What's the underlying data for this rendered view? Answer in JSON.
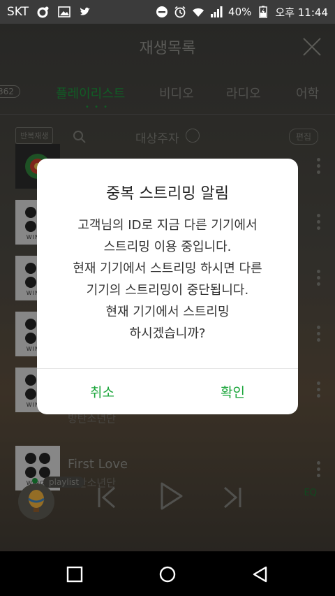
{
  "status_bar": {
    "carrier": "SKT",
    "battery": "40%",
    "time": "오후 11:44"
  },
  "header": {
    "title": "재생목록"
  },
  "tabs": {
    "count": "362",
    "items": [
      "플레이리스트",
      "비디오",
      "라디오",
      "어학"
    ],
    "active_index": 0
  },
  "toolbar": {
    "repeat_label": "반복재생",
    "sort_label": "대상주자",
    "edit_label": "편집"
  },
  "songs": [
    {
      "title": "First Love",
      "artist": "방탄소년단"
    },
    {
      "title": "",
      "artist": "방탄소년단"
    }
  ],
  "thumb_word": "WINGS",
  "player": {
    "playlist_label": "playlist",
    "eq_label": "EQ"
  },
  "dialog": {
    "title": "중복 스트리밍 알림",
    "lines": [
      "고객님의 ID로 지금 다른 기기에서",
      "스트리밍 이용 중입니다.",
      "현재 기기에서 스트리밍 하시면 다른",
      "기기의 스트리밍이 중단됩니다.",
      "현재 기기에서 스트리밍",
      "하시겠습니까?"
    ],
    "cancel_label": "취소",
    "confirm_label": "확인"
  },
  "colors": {
    "accent": "#1aa53a"
  }
}
